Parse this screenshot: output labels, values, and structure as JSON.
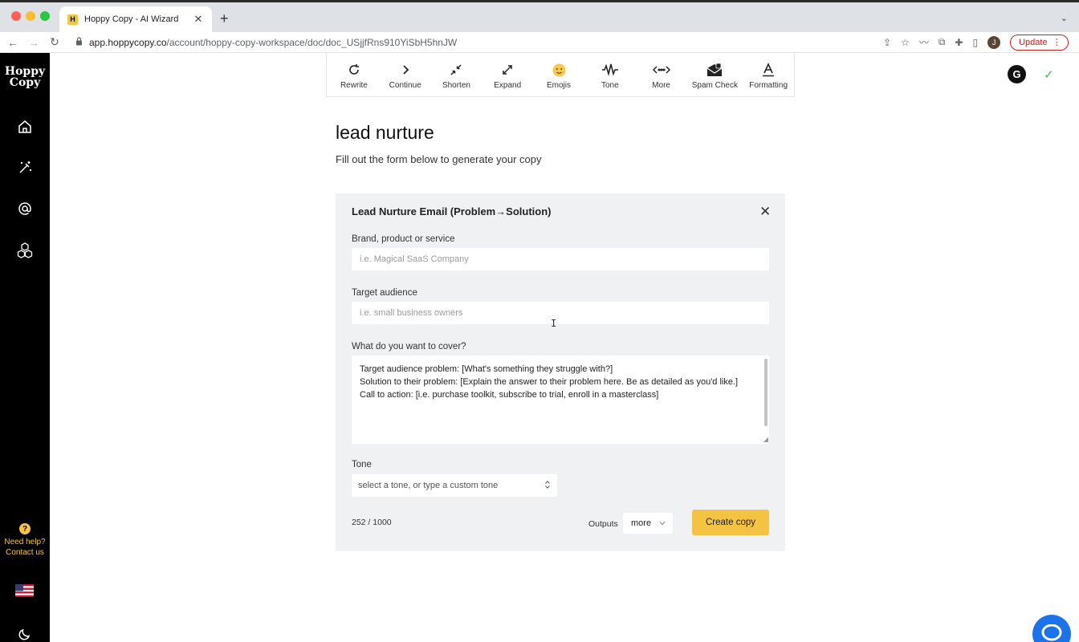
{
  "browser": {
    "tab_title": "Hoppy Copy - AI Wizard",
    "favicon_letter": "H",
    "new_tab": "+",
    "url_host": "app.hoppycopy.co",
    "url_path": "/account/hoppy-copy-workspace/doc/doc_USjjfRns910YiSbH5hnJW",
    "profile_initial": "J",
    "update_label": "Update"
  },
  "sidebar": {
    "logo_line1": "Hoppy",
    "logo_line2": "Copy",
    "help_line1": "Need help?",
    "help_line2": "Contact us",
    "help_badge": "?"
  },
  "toolbar": {
    "tools": [
      {
        "label": "Rewrite",
        "icon": "rewrite-icon"
      },
      {
        "label": "Continue",
        "icon": "chevron-right-icon"
      },
      {
        "label": "Shorten",
        "icon": "shrink-icon"
      },
      {
        "label": "Expand",
        "icon": "expand-icon"
      },
      {
        "label": "Emojis",
        "icon": "emoji-icon"
      },
      {
        "label": "Tone",
        "icon": "waveform-icon"
      },
      {
        "label": "More",
        "icon": "more-arrows-icon"
      },
      {
        "label": "Spam Check",
        "icon": "mail-alert-icon"
      },
      {
        "label": "Formatting",
        "icon": "text-format-icon"
      }
    ],
    "g_badge": "G"
  },
  "page": {
    "title": "lead nurture",
    "subtitle": "Fill out the form below to generate your copy"
  },
  "form": {
    "title": "Lead Nurture Email (Problem→Solution)",
    "brand_label": "Brand, product or service",
    "brand_placeholder": "i.e. Magical SaaS Company",
    "audience_label": "Target audience",
    "audience_placeholder": "i.e. small business owners",
    "cover_label": "What do you want to cover?",
    "cover_text": "Target audience problem: [What's something they struggle with?]\nSolution to their problem: [Explain the answer to their problem here. Be as detailed as you'd like.]\nCall to action: [i.e. purchase toolkit, subscribe to trial, enroll in a masterclass]",
    "tone_label": "Tone",
    "tone_placeholder": "select a tone, or type a custom tone",
    "char_count": "252 / 1000",
    "outputs_label": "Outputs",
    "outputs_value": "more",
    "create_label": "Create copy"
  },
  "colors": {
    "accent": "#f4c343",
    "sidebar_bg": "#000000",
    "card_bg": "#f0f1f3",
    "chat_blue": "#1a73e8"
  }
}
